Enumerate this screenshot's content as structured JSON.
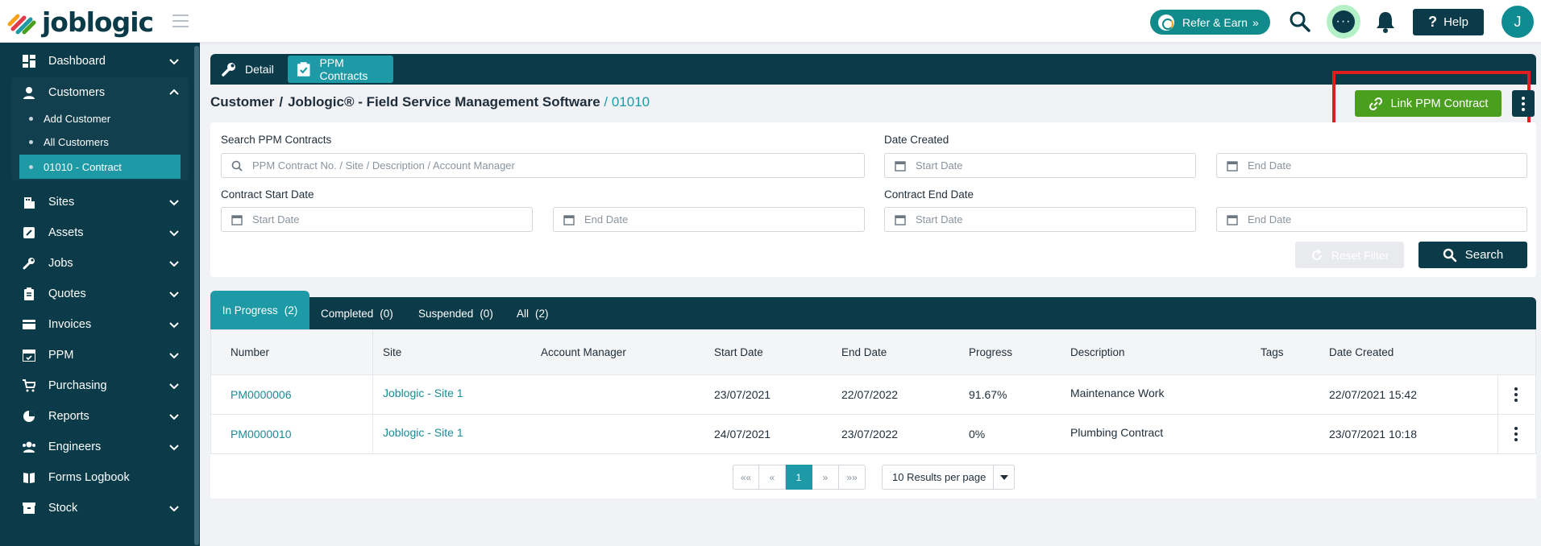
{
  "app": {
    "logo_text": "joblogic"
  },
  "topbar": {
    "refer_label": "Refer & Earn",
    "help_label": "Help",
    "avatar_initial": "J"
  },
  "sidebar": {
    "items": [
      {
        "label": "Dashboard",
        "icon": "dashboard-icon"
      },
      {
        "label": "Customers",
        "icon": "user-icon"
      },
      {
        "label": "Sites",
        "icon": "building-icon"
      },
      {
        "label": "Assets",
        "icon": "asset-icon"
      },
      {
        "label": "Jobs",
        "icon": "wrench-icon"
      },
      {
        "label": "Quotes",
        "icon": "clipboard-icon"
      },
      {
        "label": "Invoices",
        "icon": "card-icon"
      },
      {
        "label": "PPM",
        "icon": "calendar-icon"
      },
      {
        "label": "Purchasing",
        "icon": "cart-icon"
      },
      {
        "label": "Reports",
        "icon": "pie-chart-icon"
      },
      {
        "label": "Engineers",
        "icon": "engineers-icon"
      },
      {
        "label": "Forms Logbook",
        "icon": "book-icon"
      },
      {
        "label": "Stock",
        "icon": "box-icon"
      }
    ],
    "customer_sub": [
      {
        "label": "Add Customer"
      },
      {
        "label": "All Customers"
      },
      {
        "label": "01010 - Contract"
      }
    ]
  },
  "tabs": {
    "detail": "Detail",
    "ppm": "PPM Contracts"
  },
  "breadcrumb": {
    "part1": "Customer",
    "part2": "Joblogic® - Field Service Management Software",
    "current": "/ 01010"
  },
  "actions": {
    "link_ppm": "Link PPM Contract"
  },
  "filters": {
    "search_label": "Search PPM Contracts",
    "search_placeholder": "PPM Contract No. / Site / Description / Account Manager",
    "date_created_label": "Date Created",
    "contract_start_label": "Contract Start Date",
    "contract_end_label": "Contract End Date",
    "start_placeholder": "Start Date",
    "end_placeholder": "End Date",
    "reset_label": "Reset Filter",
    "search_button": "Search"
  },
  "status_tabs": [
    {
      "label": "In Progress",
      "count": "(2)"
    },
    {
      "label": "Completed",
      "count": "(0)"
    },
    {
      "label": "Suspended",
      "count": "(0)"
    },
    {
      "label": "All",
      "count": "(2)"
    }
  ],
  "table": {
    "headers": [
      "Number",
      "Site",
      "Account Manager",
      "Start Date",
      "End Date",
      "Progress",
      "Description",
      "Tags",
      "Date Created"
    ],
    "rows": [
      {
        "number": "PM0000006",
        "site": "Joblogic - Site 1",
        "account_manager": "",
        "start": "23/07/2021",
        "end": "22/07/2022",
        "progress": "91.67%",
        "description": "Maintenance Work",
        "tags": "",
        "created": "22/07/2021 15:42"
      },
      {
        "number": "PM0000010",
        "site": "Joblogic - Site 1",
        "account_manager": "",
        "start": "24/07/2021",
        "end": "23/07/2022",
        "progress": "0%",
        "description": "Plumbing Contract",
        "tags": "",
        "created": "23/07/2021 10:18"
      }
    ]
  },
  "pagination": {
    "first": "««",
    "prev": "«",
    "current": "1",
    "next": "»",
    "last": "»»",
    "per_page": "10 Results per page"
  },
  "colors": {
    "navy": "#0b3a48",
    "teal": "#1d9aa6",
    "green": "#4a9f1f",
    "highlight_red": "#e01e1e"
  }
}
